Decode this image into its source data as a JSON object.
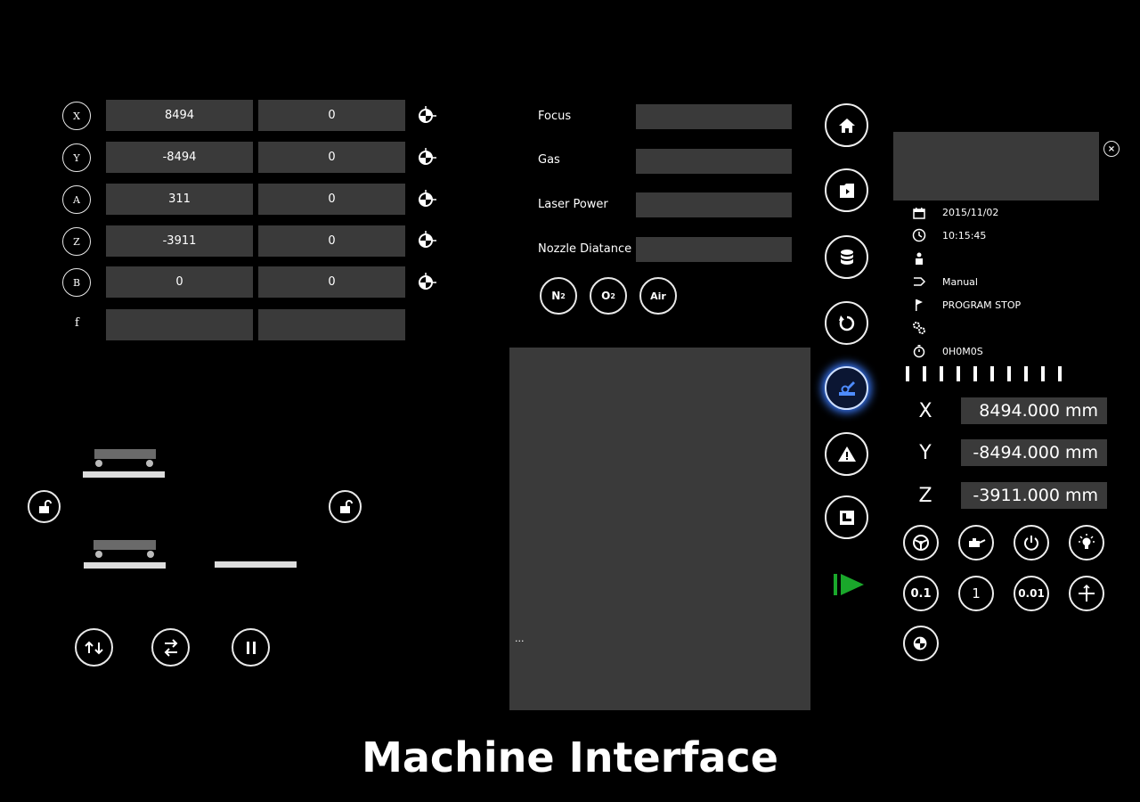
{
  "axes": [
    {
      "name": "X",
      "value": "8494",
      "offset": "0"
    },
    {
      "name": "Y",
      "value": "-8494",
      "offset": "0"
    },
    {
      "name": "A",
      "value": "311",
      "offset": "0"
    },
    {
      "name": "Z",
      "value": "-3911",
      "offset": "0"
    },
    {
      "name": "B",
      "value": "0",
      "offset": "0"
    }
  ],
  "feed": {
    "label": "f",
    "value": "",
    "offset": ""
  },
  "laser": {
    "focus_label": "Focus",
    "gas_label": "Gas",
    "power_label": "Laser Power",
    "nozzle_label": "Nozzle Diatance",
    "focus_value": "",
    "gas_value": "",
    "power_value": "",
    "nozzle_value": ""
  },
  "gas_buttons": {
    "n2": "N",
    "n2_sub": "2",
    "o2": "O",
    "o2_sub": "2",
    "air": "Air"
  },
  "program_panel": {
    "text": "..."
  },
  "status": {
    "date": "2015/11/02",
    "time": "10:15:45",
    "user": "",
    "mode": "Manual",
    "program_state": "PROGRAM STOP",
    "settings": "",
    "runtime": "0H0M0S"
  },
  "readouts": [
    {
      "axis": "X",
      "value": "8494.000 mm"
    },
    {
      "axis": "Y",
      "value": "-8494.000 mm"
    },
    {
      "axis": "Z",
      "value": "-3911.000 mm"
    }
  ],
  "controls": {
    "step_01": "0.1",
    "step_1": "1",
    "step_001": "0.01"
  },
  "caption": "Machine Interface",
  "colors": {
    "accent": "#3c7cff",
    "play": "#1aa82b",
    "field": "#3a3a3a"
  }
}
